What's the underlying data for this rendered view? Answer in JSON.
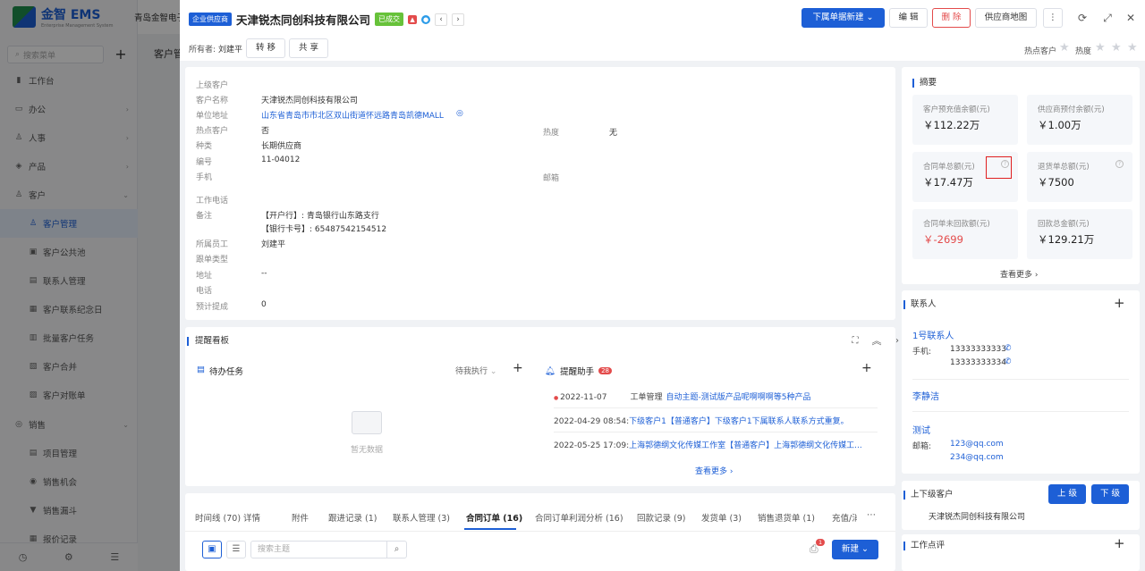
{
  "bg": {
    "logo": "金智 EMS",
    "logo_sub": "Enterprise Management System",
    "company": "青岛金智电子",
    "search_placeholder": "搜索菜单",
    "page_title": "客户管",
    "nav": [
      {
        "label": "工作台",
        "icon": "▮",
        "level": "top"
      },
      {
        "label": "办公",
        "icon": "▭",
        "level": "top",
        "arrow": "›"
      },
      {
        "label": "人事",
        "icon": "♙",
        "level": "top",
        "arrow": "›"
      },
      {
        "label": "产品",
        "icon": "◈",
        "level": "top",
        "arrow": "›"
      },
      {
        "label": "客户",
        "icon": "♙",
        "level": "top",
        "arrow": "⌄",
        "open": true
      },
      {
        "label": "客户管理",
        "icon": "♙",
        "level": "sub",
        "active": true
      },
      {
        "label": "客户公共池",
        "icon": "▣",
        "level": "sub"
      },
      {
        "label": "联系人管理",
        "icon": "▤",
        "level": "sub"
      },
      {
        "label": "客户联系纪念日",
        "icon": "▦",
        "level": "sub"
      },
      {
        "label": "批量客户任务",
        "icon": "▥",
        "level": "sub"
      },
      {
        "label": "客户合并",
        "icon": "▧",
        "level": "sub"
      },
      {
        "label": "客户对账单",
        "icon": "▨",
        "level": "sub"
      },
      {
        "label": "销售",
        "icon": "◎",
        "level": "top",
        "arrow": "⌄"
      },
      {
        "label": "项目管理",
        "icon": "▤",
        "level": "sub"
      },
      {
        "label": "销售机会",
        "icon": "◉",
        "level": "sub"
      },
      {
        "label": "销售漏斗",
        "icon": "▼",
        "level": "sub"
      },
      {
        "label": "报价记录",
        "icon": "▦",
        "level": "sub"
      }
    ]
  },
  "header": {
    "type_tag": "企业供应商",
    "company": "天津锐杰同创科技有限公司",
    "status_tag": "已成交",
    "owner_label": "所有者:",
    "owner": "刘建平",
    "transfer": "转 移",
    "share": "共 享",
    "new_sub_btn": "下属单据新建",
    "edit": "编 辑",
    "delete": "删 除",
    "map": "供应商地图",
    "hot_customer": "热点客户",
    "heat": "热度"
  },
  "info": {
    "rows": [
      {
        "label": "上级客户",
        "value": ""
      },
      {
        "label": "客户名称",
        "value": "天津锐杰同创科技有限公司"
      },
      {
        "label": "单位地址",
        "value": "山东省青岛市市北区双山街道怀远路青岛凯德MALL"
      },
      {
        "label": "热点客户",
        "value": "否"
      },
      {
        "label": "种类",
        "value": "长期供应商"
      },
      {
        "label": "编号",
        "value": "11-04012"
      },
      {
        "label": "手机",
        "value": ""
      },
      {
        "label": "工作电话",
        "value": ""
      },
      {
        "label": "备注",
        "value": "【开户行】: 青岛银行山东路支行"
      },
      {
        "label": "",
        "value": "【银行卡号】: 65487542154512"
      },
      {
        "label": "所属员工",
        "value": "刘建平"
      },
      {
        "label": "跟单类型",
        "value": ""
      },
      {
        "label": "地址",
        "value": "--"
      },
      {
        "label": "电话",
        "value": ""
      },
      {
        "label": "预计提成",
        "value": "0"
      }
    ],
    "heat_label": "热度",
    "heat_value": "无",
    "email_label": "邮箱"
  },
  "remind": {
    "title": "提醒看板",
    "todo_title": "待办任务",
    "todo_filter": "待我执行",
    "empty": "暂无数据",
    "assistant_title": "提醒助手",
    "assistant_count": "28",
    "items": [
      {
        "time": "2022-11-07",
        "prefix": "工单管理",
        "text": "自动主题-测试版产品呢啊啊啊等5种产品"
      },
      {
        "time": "2022-04-29 08:54:",
        "prefix": "",
        "text": "下级客户1【普通客户】下级客户1下属联系人联系方式重复。"
      },
      {
        "time": "2022-05-25 17:09:",
        "prefix": "",
        "text": "上海郭德纲文化传媒工作室【普通客户】上海郭德纲文化传媒工..."
      }
    ],
    "more": "查看更多"
  },
  "tabs": [
    "时间线 (70)",
    "详情",
    "附件",
    "跟进记录 (1)",
    "联系人管理 (3)",
    "合同订单 (16)",
    "合同订单利润分析 (16)",
    "回款记录 (9)",
    "发货单 (3)",
    "销售退货单 (1)",
    "充值/消"
  ],
  "toolbar": {
    "search_placeholder": "搜索主题",
    "badge": "1",
    "new_btn": "新建"
  },
  "summary": {
    "title": "摘要",
    "boxes": [
      {
        "label": "客户预充值余额(元)",
        "value": "￥112.22万",
        "color": "#222"
      },
      {
        "label": "供应商预付余额(元)",
        "value": "￥1.00万",
        "color": "#222"
      },
      {
        "label": "合同单总额(元)",
        "value": "￥17.47万",
        "color": "#222"
      },
      {
        "label": "退货单总额(元)",
        "value": "￥7500",
        "color": "#222"
      },
      {
        "label": "合同单未回款额(元)",
        "value": "￥-2699",
        "color": "#e34b4b"
      },
      {
        "label": "回款总金额(元)",
        "value": "￥129.21万",
        "color": "#222"
      }
    ],
    "more": "查看更多"
  },
  "contacts": {
    "title": "联系人",
    "list": [
      {
        "name": "1号联系人",
        "label": "手机:",
        "values": [
          "13333333333",
          "13333333334"
        ],
        "phone": true
      },
      {
        "name": "李静洁",
        "label": "",
        "values": [],
        "phone": false
      },
      {
        "name": "测试",
        "label": "邮箱:",
        "values": [
          "123@qq.com",
          "234@qq.com"
        ],
        "phone": false
      }
    ]
  },
  "relations": {
    "title": "上下级客户",
    "up": "上 级",
    "down": "下 级",
    "company": "天津锐杰同创科技有限公司"
  },
  "review": {
    "title": "工作点评"
  }
}
